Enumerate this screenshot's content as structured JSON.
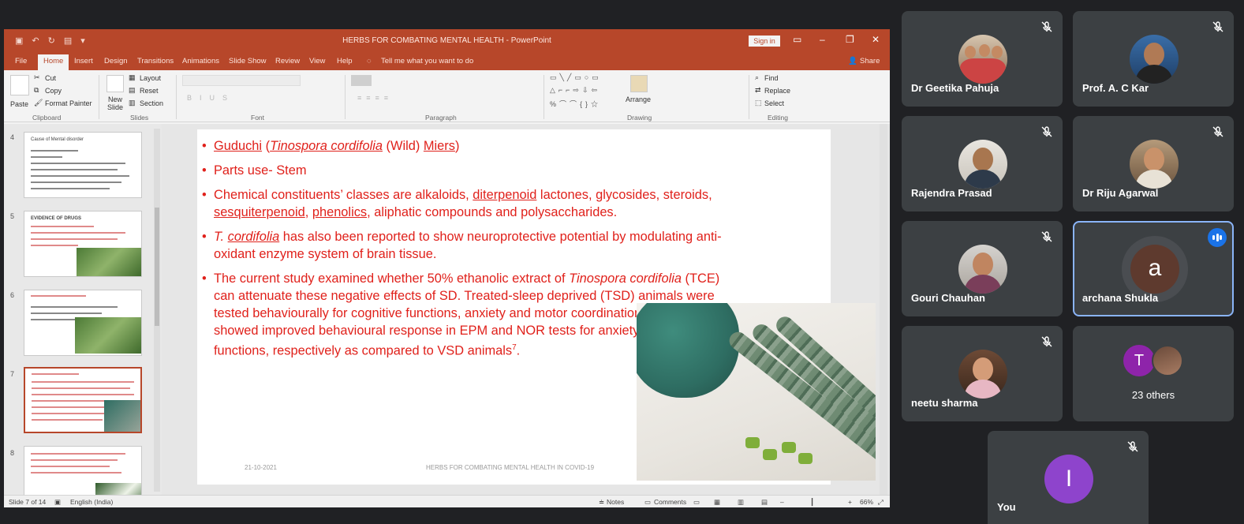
{
  "ppt": {
    "title": "HERBS FOR COMBATING MENTAL HEALTH  -  PowerPoint",
    "sign_in": "Sign in",
    "tabs": [
      "File",
      "Home",
      "Insert",
      "Design",
      "Transitions",
      "Animations",
      "Slide Show",
      "Review",
      "View",
      "Help"
    ],
    "tell_me": "Tell me what you want to do",
    "share": "Share",
    "clipboard": {
      "paste": "Paste",
      "cut": "Cut",
      "copy": "Copy",
      "format_painter": "Format Painter",
      "group": "Clipboard"
    },
    "slides_grp": {
      "new_slide": "New Slide",
      "layout": "Layout",
      "reset": "Reset",
      "section": "Section",
      "group": "Slides"
    },
    "font_grp": "Font",
    "paragraph_grp": "Paragraph",
    "drawing": {
      "arrange": "Arrange",
      "group": "Drawing"
    },
    "editing": {
      "find": "Find",
      "replace": "Replace",
      "select": "Select",
      "group": "Editing"
    },
    "thumb_numbers": [
      "4",
      "5",
      "6",
      "7",
      "8"
    ],
    "thumb_titles": [
      "Cause of Mental disorder",
      "EVIDENCE OF DRUGS"
    ],
    "status": {
      "slide": "Slide 7 of 14",
      "lang": "English (India)",
      "notes": "Notes",
      "comments": "Comments",
      "zoom": "66%"
    }
  },
  "slide": {
    "b1": {
      "name": "Guduchi",
      "open": " (",
      "species": "Tinospora cordifolia",
      "mid": " (Wild) ",
      "author": "Miers",
      "close": ")"
    },
    "b2": "Parts use- Stem",
    "b3": {
      "t1": "Chemical constituents’ classes are alkaloids, ",
      "w1": "diterpenoid",
      "t2": " lactones, glycosides, steroids, ",
      "w2": "sesquiterpenoid",
      "t3": ", ",
      "w3": "phenolics",
      "t4": ", aliphatic compounds and polysaccharides."
    },
    "b4": {
      "t": "T. ",
      "w": "cordifolia",
      "rest": " has also been reported to show neuroprotective potential by modulating anti-oxidant enzyme system of brain tissue."
    },
    "b5": {
      "t1": "The current study examined whether 50% ethanolic extract of ",
      "i1": "Tinospora cordifolia",
      "t2": " (TCE) can attenuate these negative effects of SD. Treated-sleep deprived (TSD) animals were tested behaviourally for cognitive functions, anxiety and motor coordination. TSD animals showed improved behavioural response in EPM and NOR tests for anxiety and cognitive functions, respectively as compared to VSD animals",
      "sup": "7",
      "end": "."
    },
    "footer_date": "21-10-2021",
    "footer_title": "HERBS FOR COMBATING MENTAL HEALTH IN COVID-19"
  },
  "participants": [
    {
      "name": "Dr Geetika Pahuja"
    },
    {
      "name": "Prof. A. C Kar"
    },
    {
      "name": "Rajendra Prasad"
    },
    {
      "name": "Dr Riju Agarwal"
    },
    {
      "name": "Gouri Chauhan"
    },
    {
      "name": "archana Shukla",
      "initial": "a"
    },
    {
      "name": "neetu sharma"
    },
    {
      "name": "You",
      "initial": "I"
    }
  ],
  "others": {
    "initial": "T",
    "label": "23 others"
  },
  "colors": {
    "ppt_accent": "#b7472a",
    "slide_text": "#e0211b",
    "tile_bg": "#3c4043",
    "speaking": "#8ab4f8"
  }
}
